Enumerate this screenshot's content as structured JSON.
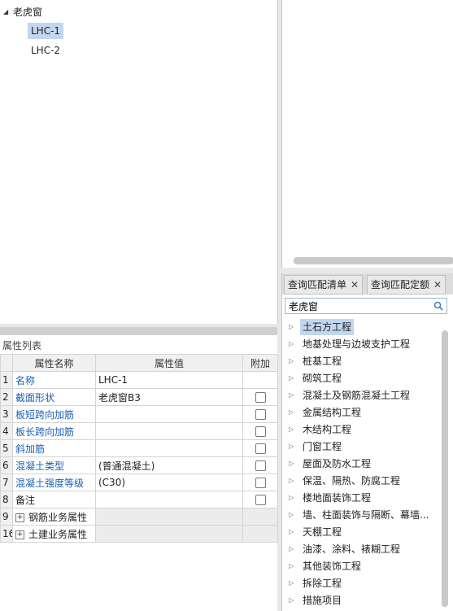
{
  "tree": {
    "root_label": "老虎窗",
    "children": [
      {
        "label": "LHC-1",
        "selected": true
      },
      {
        "label": "LHC-2",
        "selected": false
      }
    ]
  },
  "properties": {
    "title": "属性列表",
    "headers": {
      "name": "属性名称",
      "value": "属性值",
      "extra": "附加"
    },
    "rows": [
      {
        "idx": "1",
        "name": "名称",
        "value": "LHC-1",
        "blue": true,
        "checkbox": false,
        "expand": false
      },
      {
        "idx": "2",
        "name": "截面形状",
        "value": "老虎窗B3",
        "blue": true,
        "checkbox": true,
        "expand": false
      },
      {
        "idx": "3",
        "name": "板短跨向加筋",
        "value": "",
        "blue": true,
        "checkbox": true,
        "expand": false
      },
      {
        "idx": "4",
        "name": "板长跨向加筋",
        "value": "",
        "blue": true,
        "checkbox": true,
        "expand": false
      },
      {
        "idx": "5",
        "name": "斜加筋",
        "value": "",
        "blue": true,
        "checkbox": true,
        "expand": false
      },
      {
        "idx": "6",
        "name": "混凝土类型",
        "value": "(普通混凝土)",
        "blue": true,
        "checkbox": true,
        "expand": false
      },
      {
        "idx": "7",
        "name": "混凝土强度等级",
        "value": "(C30)",
        "blue": true,
        "checkbox": true,
        "expand": false
      },
      {
        "idx": "8",
        "name": "备注",
        "value": "",
        "blue": false,
        "checkbox": true,
        "expand": false
      },
      {
        "idx": "9",
        "name": "钢筋业务属性",
        "value": "",
        "blue": false,
        "checkbox": false,
        "expand": true
      },
      {
        "idx": "16",
        "name": "土建业务属性",
        "value": "",
        "blue": false,
        "checkbox": false,
        "expand": true
      }
    ]
  },
  "query": {
    "tabs": [
      {
        "label": "查询匹配清单",
        "close": "✕"
      },
      {
        "label": "查询匹配定额",
        "close": "✕"
      }
    ],
    "search_value": "老虎窗",
    "items": [
      {
        "label": "土石方工程",
        "selected": true
      },
      {
        "label": "地基处理与边坡支护工程",
        "selected": false
      },
      {
        "label": "桩基工程",
        "selected": false
      },
      {
        "label": "砌筑工程",
        "selected": false
      },
      {
        "label": "混凝土及钢筋混凝土工程",
        "selected": false
      },
      {
        "label": "金属结构工程",
        "selected": false
      },
      {
        "label": "木结构工程",
        "selected": false
      },
      {
        "label": "门窗工程",
        "selected": false
      },
      {
        "label": "屋面及防水工程",
        "selected": false
      },
      {
        "label": "保温、隔热、防腐工程",
        "selected": false
      },
      {
        "label": "楼地面装饰工程",
        "selected": false
      },
      {
        "label": "墙、柱面装饰与隔断、幕墙...",
        "selected": false
      },
      {
        "label": "天棚工程",
        "selected": false
      },
      {
        "label": "油漆、涂料、裱糊工程",
        "selected": false
      },
      {
        "label": "其他装饰工程",
        "selected": false
      },
      {
        "label": "拆除工程",
        "selected": false
      },
      {
        "label": "措施项目",
        "selected": false
      }
    ]
  },
  "colors": {
    "selection": "#c2d7ef",
    "link_blue": "#1a5fb4"
  }
}
